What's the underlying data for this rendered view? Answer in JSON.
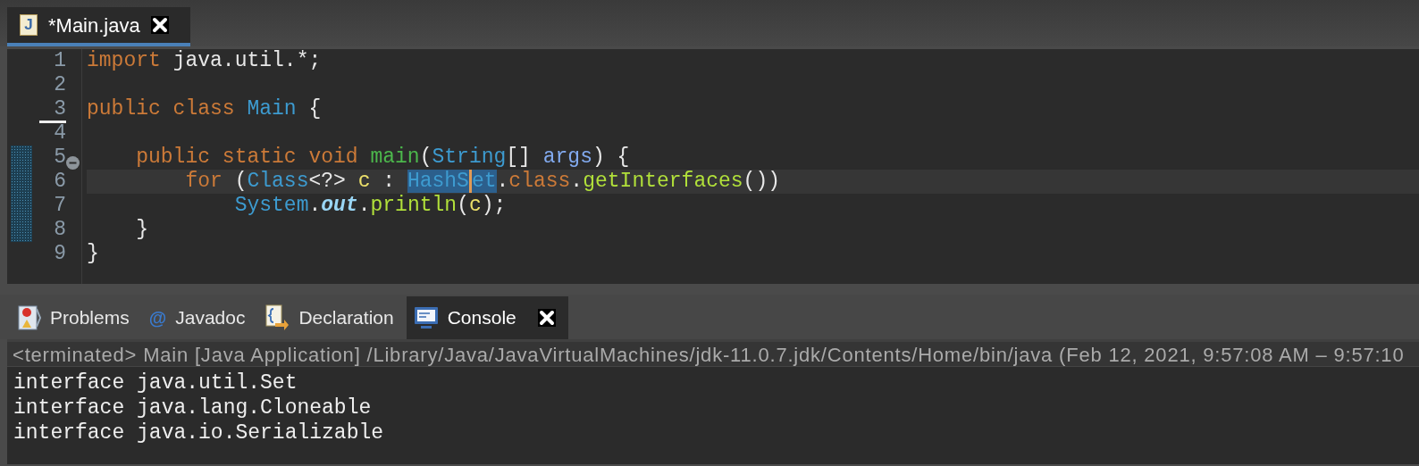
{
  "editor_tabs": [
    {
      "icon_glyph": "J",
      "title": "*Main.java",
      "selected": true,
      "closable": true
    }
  ],
  "code_lines": [
    {
      "number": "1",
      "tokens": [
        {
          "kind": "keyword",
          "text": "import"
        },
        {
          "kind": "plain",
          "text": " java.util.*;"
        }
      ]
    },
    {
      "number": "2"
    },
    {
      "number": "3",
      "marked": true,
      "tokens": [
        {
          "kind": "keyword",
          "text": "public class "
        },
        {
          "kind": "type",
          "text": "Main"
        },
        {
          "kind": "plain",
          "text": " {"
        }
      ]
    },
    {
      "number": "4"
    },
    {
      "number": "5",
      "changed": true,
      "foldable": true,
      "tokens": [
        {
          "kind": "keyword",
          "text": "    public static void "
        },
        {
          "kind": "method-decl",
          "text": "main"
        },
        {
          "kind": "plain",
          "text": "("
        },
        {
          "kind": "type",
          "text": "String"
        },
        {
          "kind": "plain",
          "text": "[] "
        },
        {
          "kind": "param",
          "text": "args"
        },
        {
          "kind": "plain",
          "text": ") {"
        }
      ]
    },
    {
      "number": "6",
      "changed": true,
      "current": true,
      "tokens": [
        {
          "kind": "keyword",
          "text": "        for"
        },
        {
          "kind": "plain",
          "text": " ("
        },
        {
          "kind": "type",
          "text": "Class"
        },
        {
          "kind": "plain",
          "text": "<?> "
        },
        {
          "kind": "var",
          "text": "c"
        },
        {
          "kind": "plain",
          "text": " : "
        },
        {
          "kind": "type",
          "text": "HashS",
          "selected": true
        },
        {
          "kind": "type",
          "text": "et",
          "selected": true,
          "caret_before": true
        },
        {
          "kind": "plain",
          "text": "."
        },
        {
          "kind": "keyword",
          "text": "class"
        },
        {
          "kind": "plain",
          "text": "."
        },
        {
          "kind": "method",
          "text": "getInterfaces"
        },
        {
          "kind": "plain",
          "text": "())"
        }
      ]
    },
    {
      "number": "7",
      "changed": true,
      "tokens": [
        {
          "kind": "type",
          "text": "            System"
        },
        {
          "kind": "plain",
          "text": "."
        },
        {
          "kind": "static-field",
          "text": "out"
        },
        {
          "kind": "plain",
          "text": "."
        },
        {
          "kind": "method",
          "text": "println"
        },
        {
          "kind": "plain",
          "text": "("
        },
        {
          "kind": "var",
          "text": "c"
        },
        {
          "kind": "plain",
          "text": ");"
        }
      ]
    },
    {
      "number": "8",
      "changed": true,
      "tokens": [
        {
          "kind": "plain",
          "text": "    }"
        }
      ]
    },
    {
      "number": "9",
      "tokens": [
        {
          "kind": "plain",
          "text": "}"
        }
      ]
    }
  ],
  "panel_tabs": [
    {
      "kind": "problems",
      "title": "Problems",
      "selected": false,
      "closable": false
    },
    {
      "kind": "at",
      "icon_glyph": "@",
      "title": "Javadoc",
      "selected": false,
      "closable": false
    },
    {
      "kind": "declaration",
      "title": "Declaration",
      "selected": false,
      "closable": false
    },
    {
      "kind": "console",
      "title": "Console",
      "selected": true,
      "closable": true
    }
  ],
  "console": {
    "status": "<terminated> Main [Java Application] /Library/Java/JavaVirtualMachines/jdk-11.0.7.jdk/Contents/Home/bin/java  (Feb 12, 2021, 9:57:08 AM – 9:57:10",
    "output": [
      "interface java.util.Set",
      "interface java.lang.Cloneable",
      "interface java.io.Serializable"
    ]
  }
}
